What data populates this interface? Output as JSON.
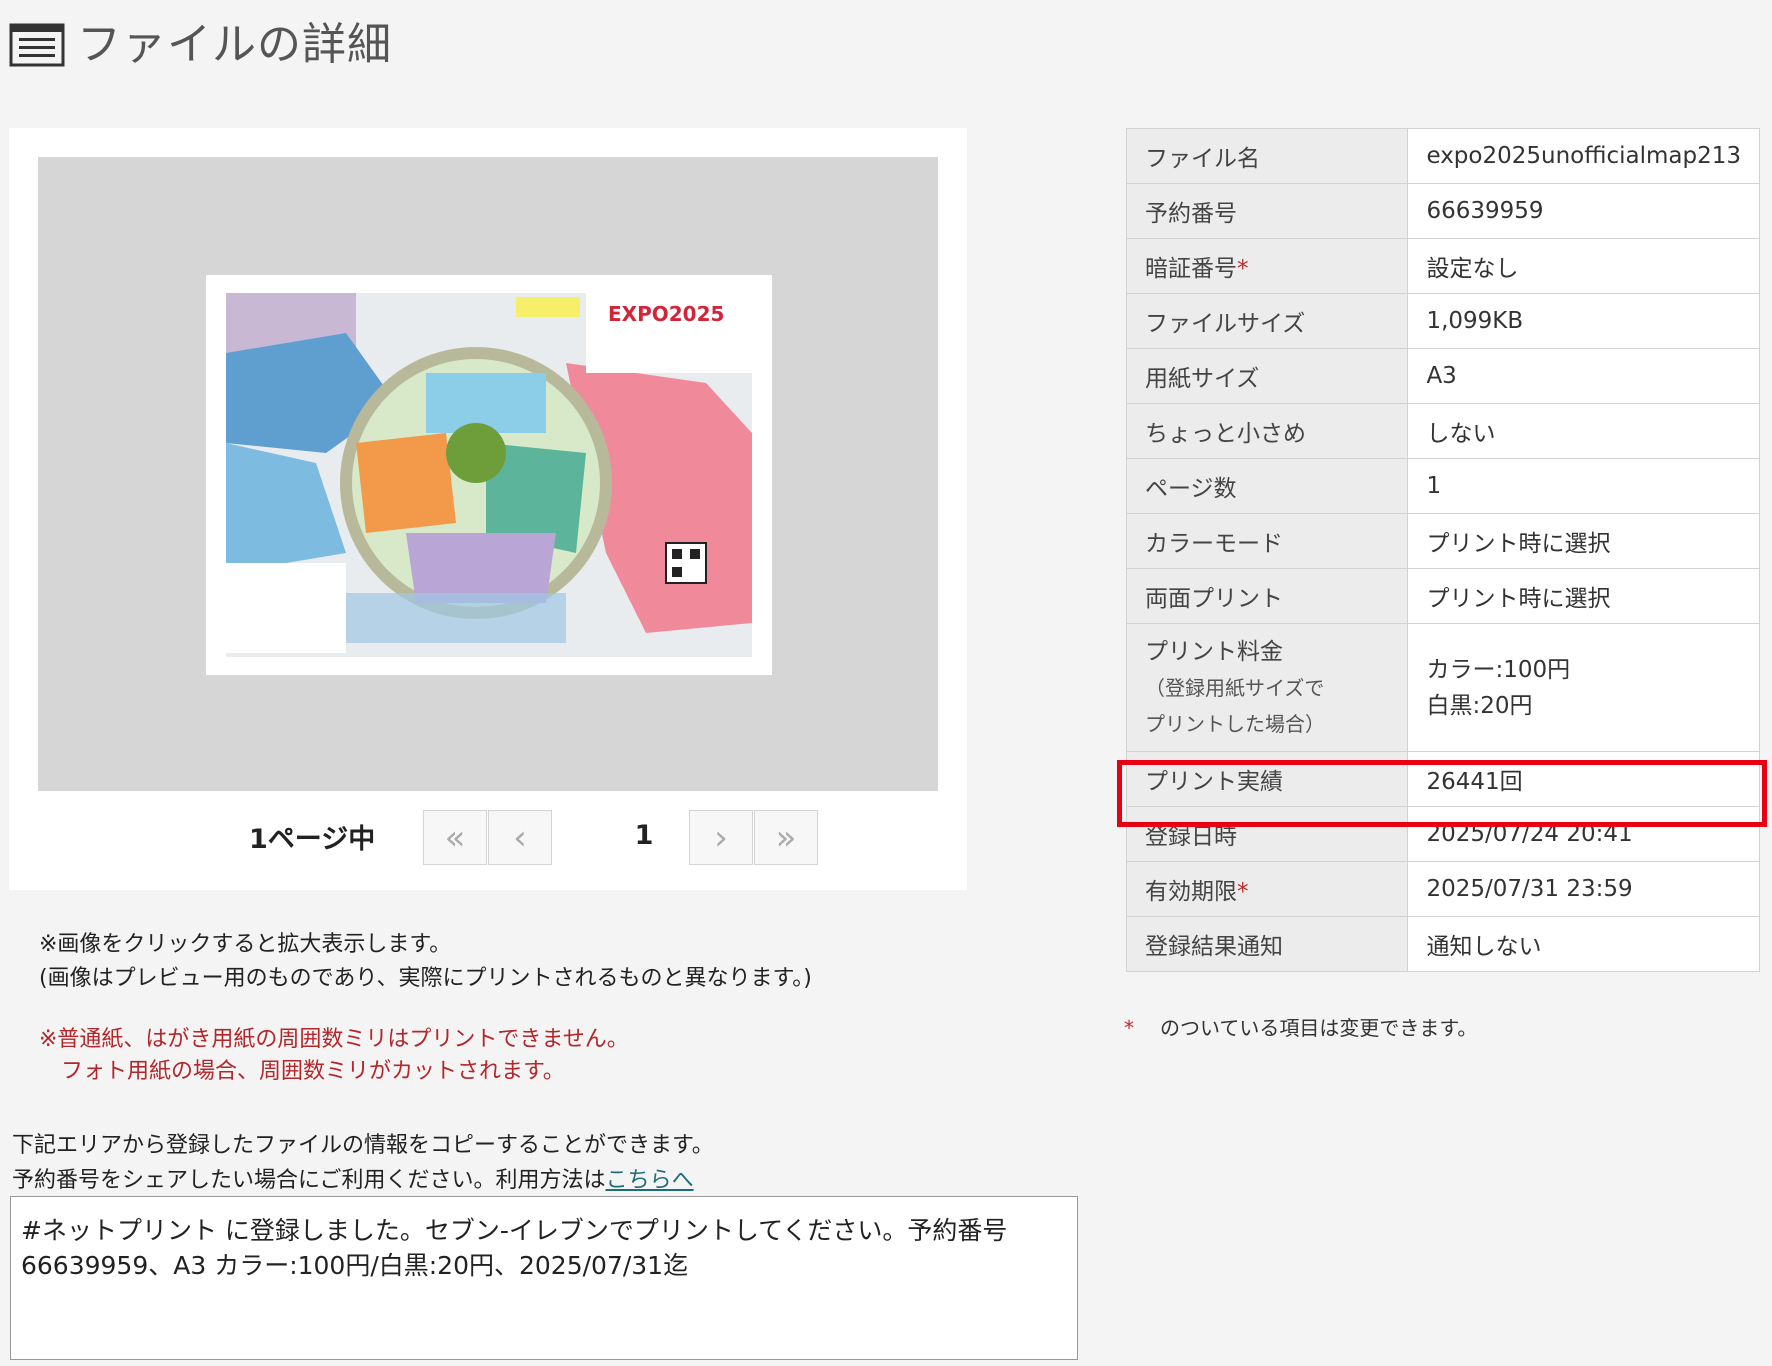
{
  "page": {
    "title": "ファイルの詳細"
  },
  "preview": {
    "page_count_label": "1ページ中",
    "current_page": "1",
    "nav": {
      "first": "«",
      "prev": "‹",
      "next": "›",
      "last": "»"
    },
    "map_logo_text": "EXPO2025"
  },
  "notes": {
    "click_hint": "※画像をクリックすると拡大表示します。",
    "preview_disclaimer": "(画像はプレビュー用のものであり、実際にプリントされるものと異なります。)",
    "warning_line1": "※普通紙、はがき用紙の周囲数ミリはプリントできません。",
    "warning_line2": "フォト用紙の場合、周囲数ミリがカットされます。"
  },
  "share": {
    "desc_line1": "下記エリアから登録したファイルの情報をコピーすることができます。",
    "desc_line2": "予約番号をシェアしたい場合にご利用ください。利用方法は",
    "link_text": "こちらへ",
    "text": "#ネットプリント に登録しました。セブン-イレブンでプリントしてください。予約番号66639959、A3 カラー:100円/白黒:20円、2025/07/31迄"
  },
  "details": {
    "file_name_label": "ファイル名",
    "file_name": "expo2025unofficialmap213",
    "reservation_label": "予約番号",
    "reservation": "66639959",
    "pin_label": "暗証番号",
    "pin": "設定なし",
    "file_size_label": "ファイルサイズ",
    "file_size": "1,099KB",
    "paper_size_label": "用紙サイズ",
    "paper_size": "A3",
    "shrink_label": "ちょっと小さめ",
    "shrink": "しない",
    "pages_label": "ページ数",
    "pages": "1",
    "color_mode_label": "カラーモード",
    "color_mode": "プリント時に選択",
    "duplex_label": "両面プリント",
    "duplex": "プリント時に選択",
    "price_label": "プリント料金",
    "price_sub1": "（登録用紙サイズで",
    "price_sub2": "プリントした場合）",
    "price_color": "カラー:100円",
    "price_bw": "白黒:20円",
    "print_count_label": "プリント実績",
    "print_count": "26441回",
    "registered_label": "登録日時",
    "registered": "2025/07/24 20:41",
    "expiry_label": "有効期限",
    "expiry": "2025/07/31 23:59",
    "notify_label": "登録結果通知",
    "notify": "通知しない",
    "required_mark": "*",
    "footnote": "のついている項目は変更できます。"
  },
  "colors": {
    "required": "#c0282c",
    "highlight": "#e60012",
    "link": "#1e6e7a"
  }
}
